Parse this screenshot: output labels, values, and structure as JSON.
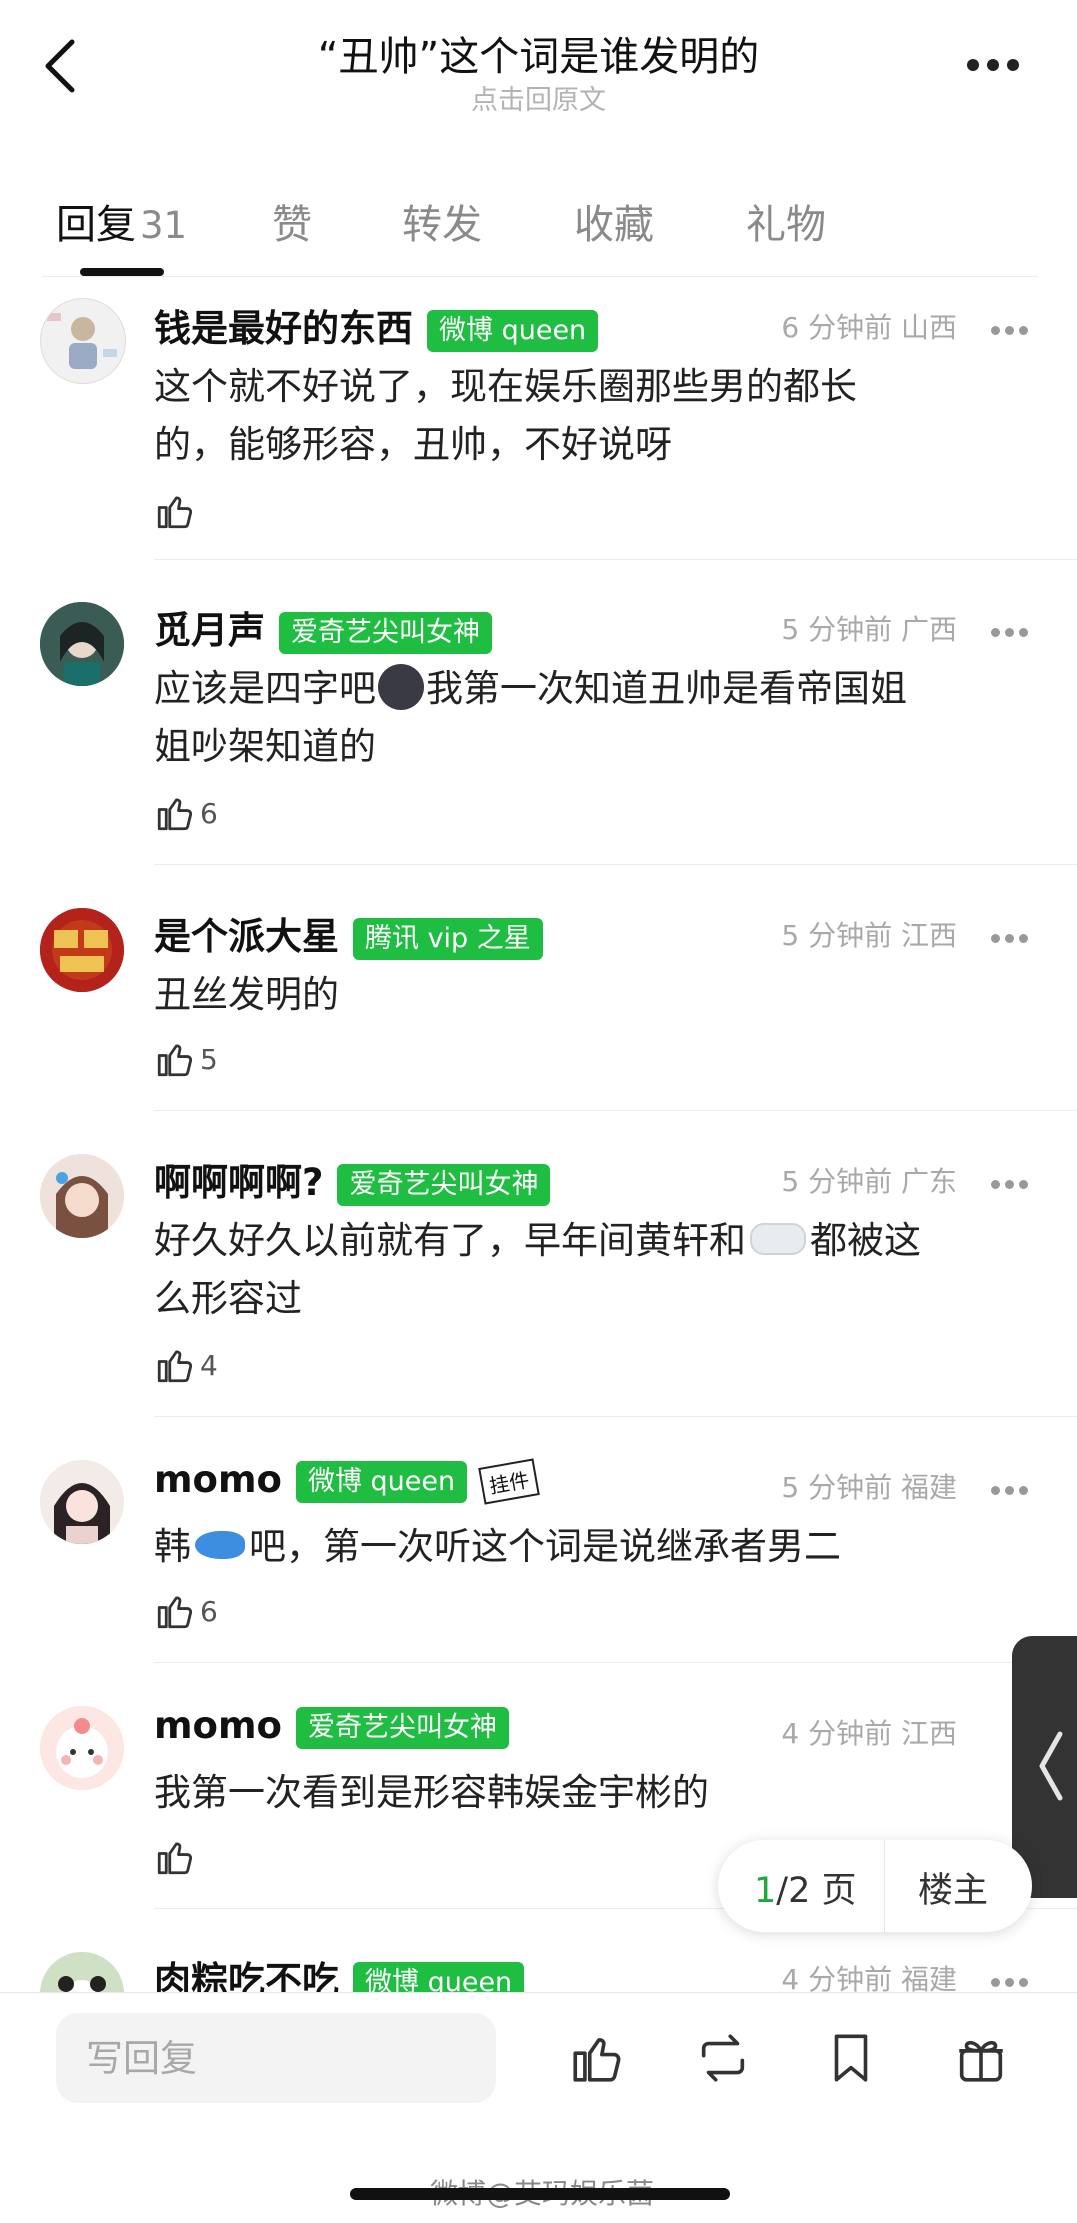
{
  "header": {
    "title": "“丑帅”这个词是谁发明的",
    "subtitle": "点击回原文"
  },
  "tabs": [
    {
      "label": "回复",
      "count": "31"
    },
    {
      "label": "赞"
    },
    {
      "label": "转发"
    },
    {
      "label": "收藏"
    },
    {
      "label": "礼物"
    }
  ],
  "comments": [
    {
      "name": "钱是最好的东西",
      "badge": "微博 queen",
      "time": "6 分钟前",
      "location": "山西",
      "text_lines": [
        "这个就不好说了，现在娱乐圈那些男的都长",
        "的，能够形容，丑帅，不好说呀"
      ],
      "likes": ""
    },
    {
      "name": "觅月声",
      "badge": "爱奇艺尖叫女神",
      "time": "5 分钟前",
      "location": "广西",
      "text_before_emoji": "应该是四字吧",
      "text_after_emoji": "我第一次知道丑帅是看帝国姐",
      "text_line2": "姐吵架知道的",
      "likes": "6"
    },
    {
      "name": "是个派大星",
      "badge": "腾讯 vip 之星",
      "time": "5 分钟前",
      "location": "江西",
      "text_lines": [
        "丑丝发明的"
      ],
      "likes": "5"
    },
    {
      "name": "啊啊啊啊?",
      "badge": "爱奇艺尖叫女神",
      "time": "5 分钟前",
      "location": "广东",
      "text_before_emoji": "好久好久以前就有了，早年间黄轩和",
      "text_after_emoji": "都被这",
      "text_line2": "么形容过",
      "likes": "4"
    },
    {
      "name": "momo",
      "badge": "微博 queen",
      "pendant": "挂件",
      "time": "5 分钟前",
      "location": "福建",
      "text_before_emoji": "韩",
      "text_after_emoji": "吧，第一次听这个词是说继承者男二",
      "likes": "6"
    },
    {
      "name": "momo",
      "badge": "爱奇艺尖叫女神",
      "time": "4 分钟前",
      "location": "江西",
      "text_lines": [
        "我第一次看到是形容韩娱金宇彬的"
      ],
      "likes": ""
    },
    {
      "name": "肉粽吃不吃",
      "badge": "微博 queen",
      "time": "4 分钟前",
      "location": "福建"
    }
  ],
  "pager": {
    "current": "1",
    "total": "/2 页",
    "owner_label": "楼主"
  },
  "bottombar": {
    "reply_placeholder": "写回复"
  },
  "watermark": "微博@艾玛娱乐菌",
  "colors": {
    "badge_green": "#1fbd41",
    "page_current": "#1fa83c"
  }
}
